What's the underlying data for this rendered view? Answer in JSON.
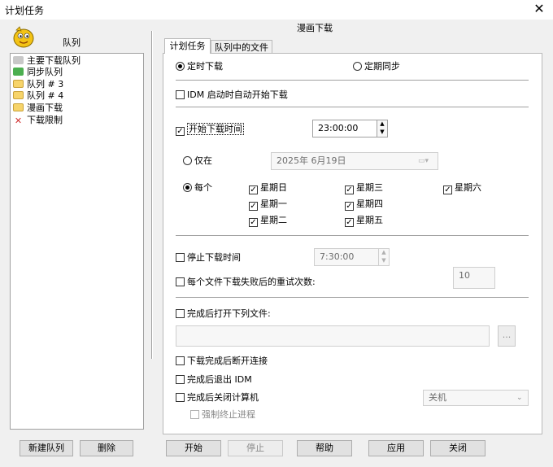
{
  "window": {
    "title": "计划任务"
  },
  "left": {
    "header": "队列",
    "queues": [
      {
        "label": "主要下载队列",
        "icon": "clock-queue-icon",
        "color": "#c8c8c8"
      },
      {
        "label": "同步队列",
        "icon": "green-folder-icon",
        "color": "#4caf50"
      },
      {
        "label": "队列 # 3",
        "icon": "folder-icon",
        "color": "#f7d46a"
      },
      {
        "label": "队列 # 4",
        "icon": "folder-icon",
        "color": "#f7d46a"
      },
      {
        "label": "漫画下载",
        "icon": "folder-icon",
        "color": "#f7d46a"
      },
      {
        "label": "下载限制",
        "icon": "red-x-icon",
        "color": "#d03030"
      }
    ],
    "new_queue_btn": "新建队列",
    "delete_btn": "删除"
  },
  "right": {
    "queue_title": "漫画下载",
    "tabs": [
      "计划任务",
      "队列中的文件"
    ],
    "radio_once": "定时下载",
    "radio_periodic": "定期同步",
    "idm_start": "IDM 启动时自动开始下载",
    "start_time_label": "开始下载时间",
    "start_time": "23:00:00",
    "only_on": "仅在",
    "date": "2025年  6月19日",
    "every": "每个",
    "days": {
      "sun": "星期日",
      "mon": "星期一",
      "tue": "星期二",
      "wed": "星期三",
      "thu": "星期四",
      "fri": "星期五",
      "sat": "星期六"
    },
    "stop_time_label": "停止下载时间",
    "stop_time": "7:30:00",
    "retry_label": "每个文件下载失败后的重试次数:",
    "retry_value": "10",
    "open_file_label": "完成后打开下列文件:",
    "browse": "...",
    "hang_up": "下载完成后断开连接",
    "exit_idm": "完成后退出 IDM",
    "shutdown": "完成后关闭计算机",
    "shutdown_option": "关机",
    "force_terminate": "强制终止进程"
  },
  "footer": {
    "start": "开始",
    "stop": "停止",
    "help": "帮助",
    "apply": "应用",
    "close": "关闭"
  },
  "colors": {
    "check": "#000000",
    "logo": "#f3c316"
  }
}
